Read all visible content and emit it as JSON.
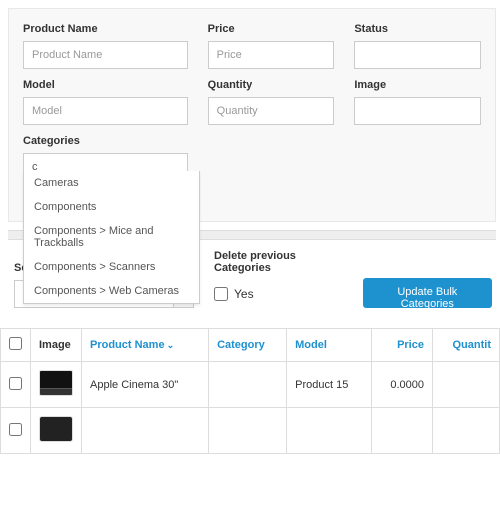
{
  "filters": {
    "productName": {
      "label": "Product Name",
      "placeholder": "Product Name",
      "value": ""
    },
    "price": {
      "label": "Price",
      "placeholder": "Price",
      "value": ""
    },
    "status": {
      "label": "Status",
      "placeholder": "",
      "value": ""
    },
    "model": {
      "label": "Model",
      "placeholder": "Model",
      "value": ""
    },
    "quantity": {
      "label": "Quantity",
      "placeholder": "Quantity",
      "value": ""
    },
    "image": {
      "label": "Image",
      "placeholder": "",
      "value": ""
    },
    "categories": {
      "label": "Categories",
      "placeholder": "",
      "value": "c"
    }
  },
  "autocomplete": {
    "items": [
      "Cameras",
      "Components",
      "Components  >  Mice and Trackballs",
      "Components  >  Scanners",
      "Components  >  Web Cameras"
    ]
  },
  "bulk": {
    "selectCategory": {
      "label": "Select Category",
      "value": ""
    },
    "deletePrev": {
      "label": "Delete previous Categories",
      "checked": false,
      "option": "Yes"
    },
    "updateBtn": "Update Bulk Categories"
  },
  "table": {
    "headers": {
      "image": "Image",
      "productName": "Product Name",
      "category": "Category",
      "model": "Model",
      "price": "Price",
      "quantity": "Quantit"
    },
    "rows": [
      {
        "name": "Apple Cinema 30\"",
        "category": "",
        "model": "Product 15",
        "price": "0.0000"
      },
      {
        "name": "",
        "category": "",
        "model": "",
        "price": ""
      }
    ]
  }
}
